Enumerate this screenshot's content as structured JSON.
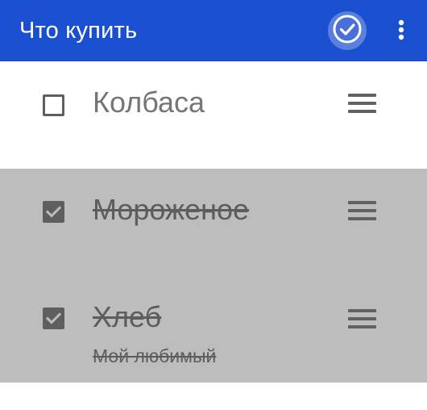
{
  "app_bar": {
    "title": "Что купить",
    "done_icon": "check-circle-icon",
    "more_icon": "more-vert-icon",
    "background_color": "#1a4fd0"
  },
  "items": [
    {
      "text": "Колбаса",
      "checked": false,
      "note": ""
    },
    {
      "text": "Мороженое",
      "checked": true,
      "note": ""
    },
    {
      "text": "Хлеб",
      "checked": true,
      "note": "Мой любимый"
    }
  ],
  "colors": {
    "checked_row_background": "#bdbdbd",
    "text_gray": "#757575"
  }
}
